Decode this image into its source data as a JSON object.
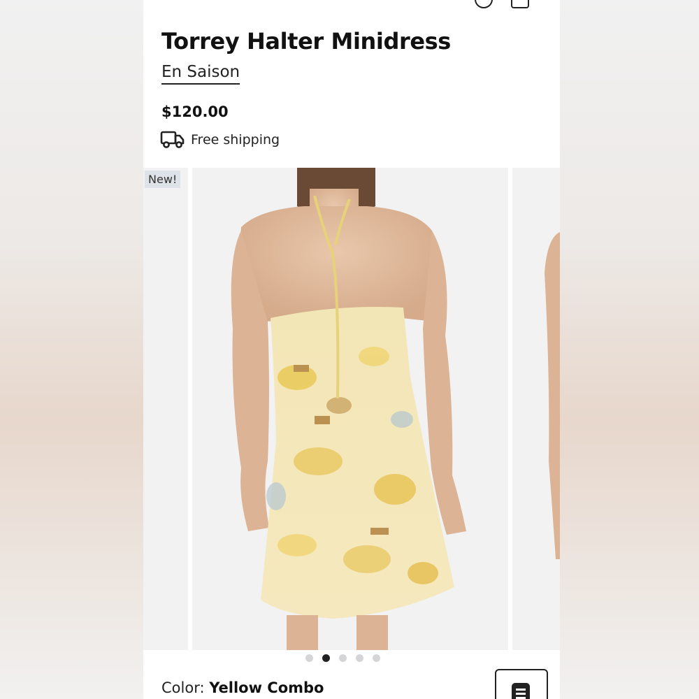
{
  "product": {
    "title": "Torrey Halter Minidress",
    "brand": "En Saison",
    "price": "$120.00",
    "shipping": "Free shipping",
    "badge": "New!"
  },
  "gallery": {
    "image_count": 5,
    "active_index": 1
  },
  "color": {
    "label": "Color:",
    "value": "Yellow Combo"
  },
  "icons": {
    "top": [
      "search-icon",
      "bag-icon"
    ],
    "shipping": "truck-icon",
    "floating": "list-icon"
  }
}
